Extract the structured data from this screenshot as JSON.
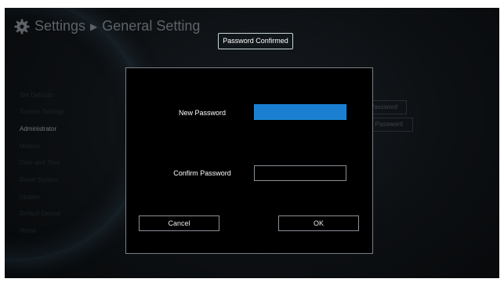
{
  "header": {
    "title": "Settings",
    "separator": "▶",
    "subtitle": "General Setting"
  },
  "toast": "Password Confirmed",
  "sidebar": {
    "items": [
      {
        "label": "Set Defaults"
      },
      {
        "label": "System Settings"
      },
      {
        "label": "Administrator"
      },
      {
        "label": "Module"
      },
      {
        "label": "Date and Time"
      },
      {
        "label": "Reset System"
      },
      {
        "label": "Update"
      },
      {
        "label": "Default Device"
      },
      {
        "label": "Home"
      }
    ],
    "active_index": 2
  },
  "background_buttons": {
    "set_password": "Password",
    "change_password": "e Password"
  },
  "dialog": {
    "new_password_label": "New Password",
    "new_password_value": "",
    "confirm_password_label": "Confirm Password",
    "confirm_password_value": "",
    "cancel_label": "Cancel",
    "ok_label": "OK"
  },
  "colors": {
    "focus_field": "#1a7fd0",
    "dialog_bg": "#000000",
    "border": "#8a9096"
  }
}
